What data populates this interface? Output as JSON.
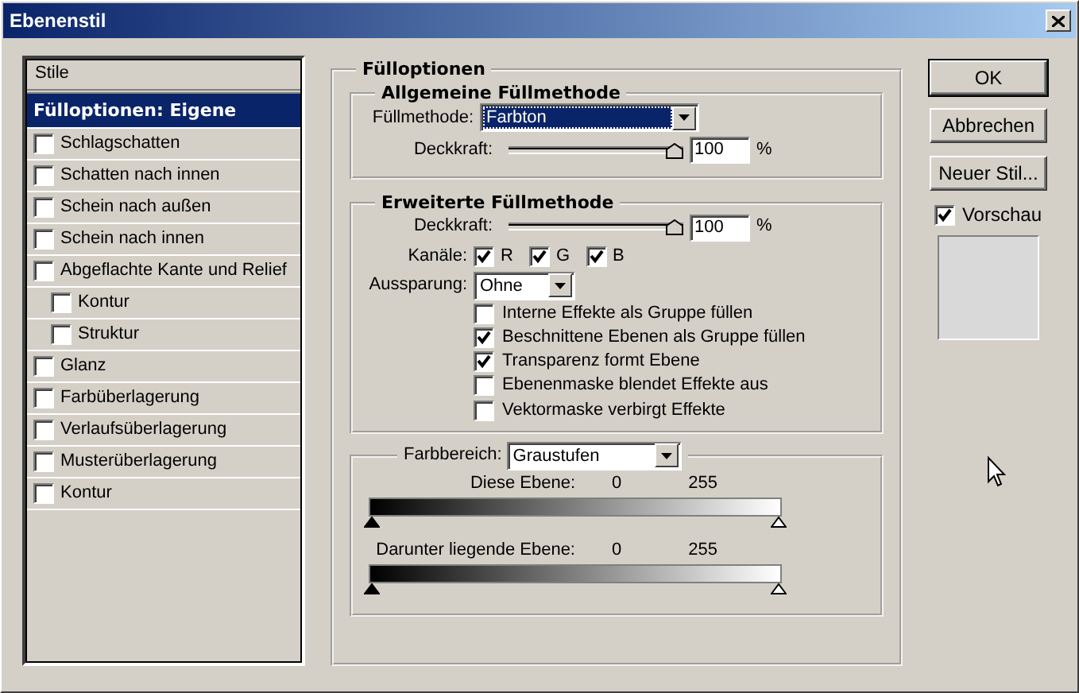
{
  "window": {
    "title": "Ebenenstil"
  },
  "styles_list": {
    "header": "Stile",
    "items": [
      {
        "kind": "heading",
        "label": "Fülloptionen: Eigene",
        "selected": true
      },
      {
        "kind": "checkbox",
        "label": "Schlagschatten",
        "checked": false,
        "selected": false
      },
      {
        "kind": "checkbox",
        "label": "Schatten nach innen",
        "checked": false,
        "selected": false
      },
      {
        "kind": "checkbox",
        "label": "Schein nach außen",
        "checked": false,
        "selected": false
      },
      {
        "kind": "checkbox",
        "label": "Schein nach innen",
        "checked": false,
        "selected": false
      },
      {
        "kind": "checkbox",
        "label": "Abgeflachte Kante und Relief",
        "checked": false,
        "selected": false,
        "children": [
          {
            "kind": "checkbox",
            "label": "Kontur",
            "checked": false,
            "selected": false
          },
          {
            "kind": "checkbox",
            "label": "Struktur",
            "checked": false,
            "selected": false
          }
        ]
      },
      {
        "kind": "checkbox",
        "label": "Glanz",
        "checked": false,
        "selected": false
      },
      {
        "kind": "checkbox",
        "label": "Farbüberlagerung",
        "checked": false,
        "selected": false
      },
      {
        "kind": "checkbox",
        "label": "Verlaufsüberlagerung",
        "checked": false,
        "selected": false
      },
      {
        "kind": "checkbox",
        "label": "Musterüberlagerung",
        "checked": false,
        "selected": false
      },
      {
        "kind": "checkbox",
        "label": "Kontur",
        "checked": false,
        "selected": false
      }
    ]
  },
  "fill_options": {
    "title": "Fülloptionen",
    "general": {
      "title": "Allgemeine Füllmethode",
      "blend_mode": {
        "label": "Füllmethode:",
        "value": "Farbton"
      },
      "opacity": {
        "label": "Deckkraft:",
        "level": 1,
        "value": "100",
        "unit": "%"
      }
    },
    "advanced": {
      "title": "Erweiterte Füllmethode",
      "opacity": {
        "label": "Deckkraft:",
        "level": 1,
        "value": "100",
        "unit": "%"
      },
      "channels": {
        "label": "Kanäle:",
        "items": [
          {
            "label": "R",
            "checked": true
          },
          {
            "label": "G",
            "checked": true
          },
          {
            "label": "B",
            "checked": true
          }
        ]
      },
      "knockout": {
        "label": "Aussparung:",
        "value": "Ohne"
      },
      "options": [
        {
          "label": "Interne Effekte als Gruppe füllen",
          "checked": false
        },
        {
          "label": "Beschnittene Ebenen als Gruppe füllen",
          "checked": true
        },
        {
          "label": "Transparenz formt Ebene",
          "checked": true
        },
        {
          "label": "Ebenenmaske blendet Effekte aus",
          "checked": false
        },
        {
          "label": "Vektormaske verbirgt Effekte",
          "checked": false
        }
      ]
    },
    "blend_if": {
      "label": "Farbbereich:",
      "value": "Graustufen",
      "ranges": [
        {
          "label": "Diese Ebene:",
          "low": "0",
          "high": "255"
        },
        {
          "label": "Darunter liegende Ebene:",
          "low": "0",
          "high": "255"
        }
      ]
    }
  },
  "buttons": [
    {
      "label": "OK",
      "default": true
    },
    {
      "label": "Abbrechen",
      "default": false
    },
    {
      "label": "Neuer Stil...",
      "default": false
    }
  ],
  "preview": {
    "label": "Vorschau",
    "checked": true
  }
}
